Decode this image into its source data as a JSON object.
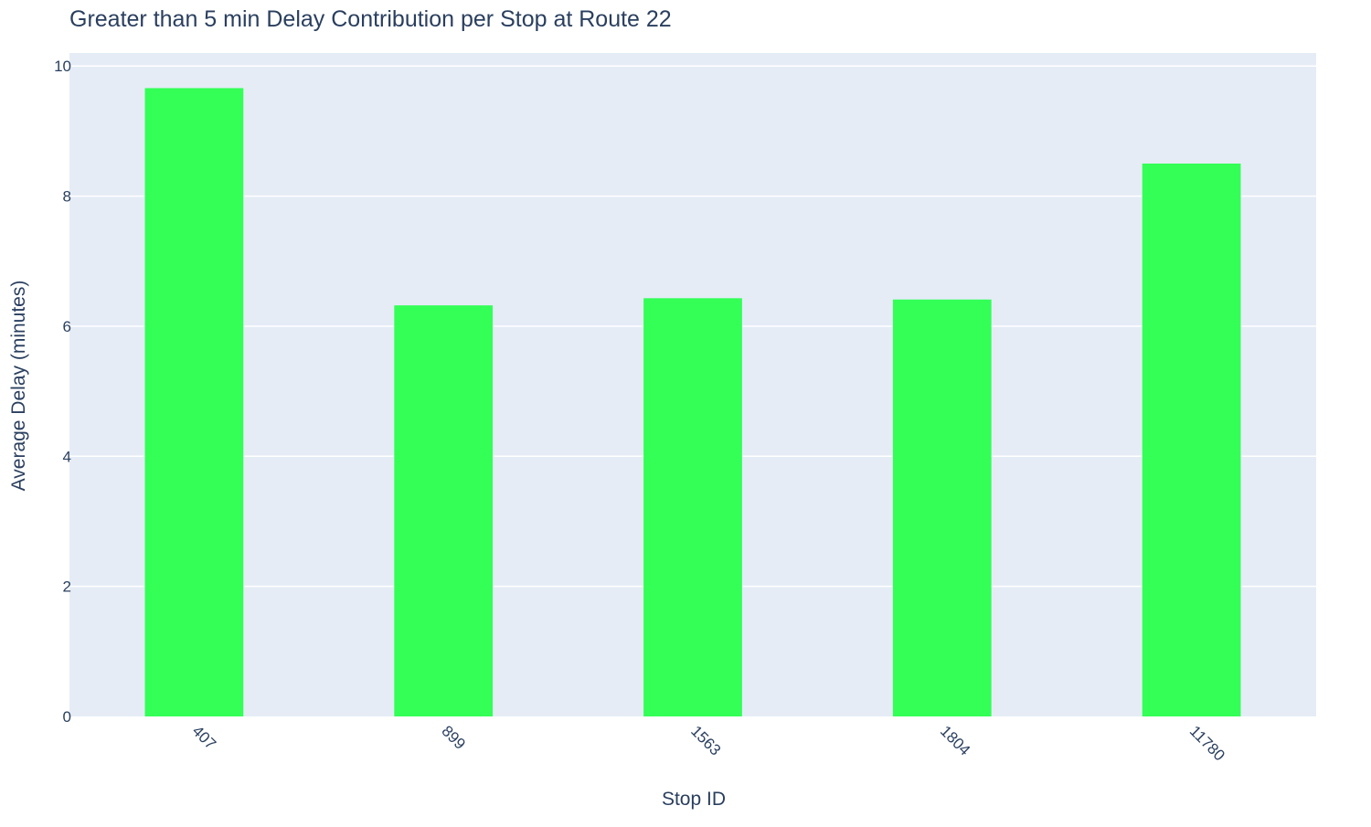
{
  "chart_data": {
    "type": "bar",
    "title": "Greater than 5 min Delay Contribution per Stop at Route 22",
    "xlabel": "Stop ID",
    "ylabel": "Average Delay (minutes)",
    "categories": [
      "407",
      "899",
      "1563",
      "1804",
      "11780"
    ],
    "values": [
      9.66,
      6.32,
      6.43,
      6.41,
      8.5
    ],
    "ylim": [
      0,
      10
    ],
    "yticks": [
      0,
      2,
      4,
      6,
      8,
      10
    ],
    "grid": true,
    "legend": "none",
    "colors": {
      "bar": "#33ff57",
      "plot_background": "#e5ecf6",
      "gridline": "#ffffff",
      "text": "#2a3f5f"
    }
  }
}
